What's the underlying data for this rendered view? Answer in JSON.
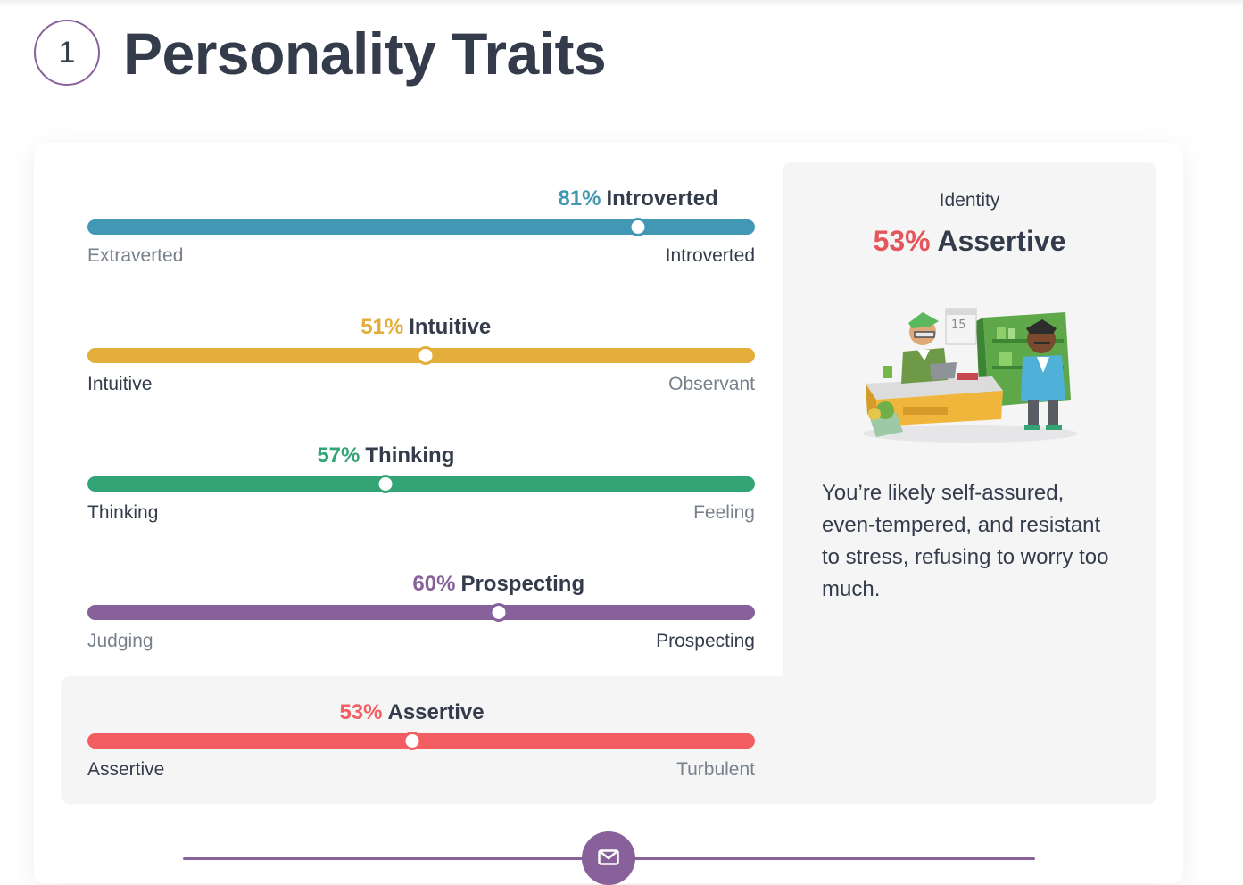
{
  "section": {
    "number": "1",
    "title": "Personality Traits"
  },
  "traits": [
    {
      "pct_text": "81%",
      "name": "Introverted",
      "left_label": "Extraverted",
      "right_label": "Introverted",
      "active_side": "right",
      "marker_percent": 82.5,
      "color": "#4298b4"
    },
    {
      "pct_text": "51%",
      "name": "Intuitive",
      "left_label": "Intuitive",
      "right_label": "Observant",
      "active_side": "left",
      "marker_percent": 50.7,
      "color": "#e4ae3a"
    },
    {
      "pct_text": "57%",
      "name": "Thinking",
      "left_label": "Thinking",
      "right_label": "Feeling",
      "active_side": "left",
      "marker_percent": 44.7,
      "color": "#33a474"
    },
    {
      "pct_text": "60%",
      "name": "Prospecting",
      "left_label": "Judging",
      "right_label": "Prospecting",
      "active_side": "right",
      "marker_percent": 61.6,
      "color": "#88619a"
    },
    {
      "pct_text": "53%",
      "name": "Assertive",
      "left_label": "Assertive",
      "right_label": "Turbulent",
      "active_side": "left",
      "marker_percent": 48.6,
      "color": "#f25e62"
    }
  ],
  "side_panel": {
    "subtitle": "Identity",
    "pct_text": "53%",
    "trait": "Assertive",
    "description": "You’re likely self-assured, even-tempered, and resistant to stress, refusing to worry too much.",
    "pct_color": "#e5555c",
    "illustration": "office-scene-illustration"
  },
  "bottom": {
    "icon": "mail-icon",
    "accent": "#88619a"
  }
}
